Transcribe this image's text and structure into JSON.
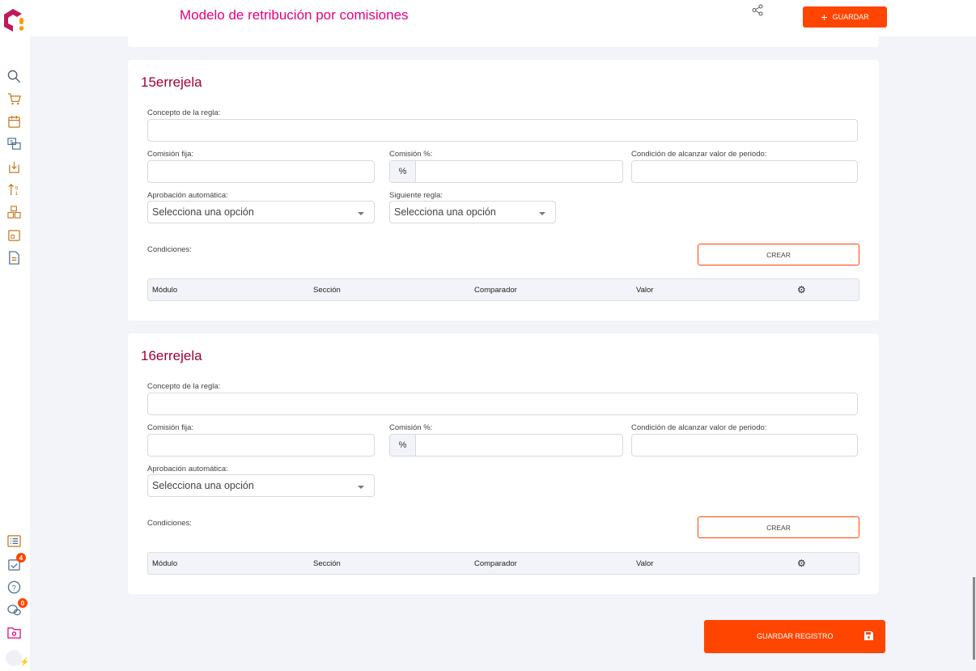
{
  "header": {
    "title": "Modelo de retribución por comisiones",
    "save_label": "GUARDAR"
  },
  "sidebar": {
    "badges": {
      "tasks": "4",
      "chat": "0"
    }
  },
  "labels": {
    "concepto": "Concepto de la regla:",
    "fija": "Comisión fija:",
    "porc": "Comisión %:",
    "condicion_periodo": "Condición de alcanzar valor de periodo:",
    "aprobacion": "Aprobación automática:",
    "siguiente": "Siguiente regla:",
    "condiciones": "Condiciones:",
    "crear": "CREAR",
    "percent": "%",
    "select_placeholder": "Selecciona una opción"
  },
  "table_headers": [
    "Módulo",
    "Sección",
    "Comparador",
    "Valor"
  ],
  "rules": [
    {
      "title": "15errejela"
    },
    {
      "title": "16errejela"
    }
  ],
  "footer": {
    "save_record": "GUARDAR REGISTRO"
  }
}
